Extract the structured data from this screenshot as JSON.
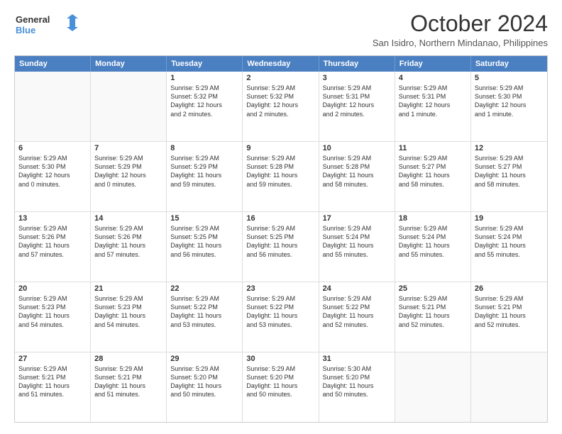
{
  "logo": {
    "line1": "General",
    "line2": "Blue"
  },
  "title": "October 2024",
  "location": "San Isidro, Northern Mindanao, Philippines",
  "weekdays": [
    "Sunday",
    "Monday",
    "Tuesday",
    "Wednesday",
    "Thursday",
    "Friday",
    "Saturday"
  ],
  "rows": [
    [
      {
        "day": "",
        "lines": []
      },
      {
        "day": "",
        "lines": []
      },
      {
        "day": "1",
        "lines": [
          "Sunrise: 5:29 AM",
          "Sunset: 5:32 PM",
          "Daylight: 12 hours",
          "and 2 minutes."
        ]
      },
      {
        "day": "2",
        "lines": [
          "Sunrise: 5:29 AM",
          "Sunset: 5:32 PM",
          "Daylight: 12 hours",
          "and 2 minutes."
        ]
      },
      {
        "day": "3",
        "lines": [
          "Sunrise: 5:29 AM",
          "Sunset: 5:31 PM",
          "Daylight: 12 hours",
          "and 2 minutes."
        ]
      },
      {
        "day": "4",
        "lines": [
          "Sunrise: 5:29 AM",
          "Sunset: 5:31 PM",
          "Daylight: 12 hours",
          "and 1 minute."
        ]
      },
      {
        "day": "5",
        "lines": [
          "Sunrise: 5:29 AM",
          "Sunset: 5:30 PM",
          "Daylight: 12 hours",
          "and 1 minute."
        ]
      }
    ],
    [
      {
        "day": "6",
        "lines": [
          "Sunrise: 5:29 AM",
          "Sunset: 5:30 PM",
          "Daylight: 12 hours",
          "and 0 minutes."
        ]
      },
      {
        "day": "7",
        "lines": [
          "Sunrise: 5:29 AM",
          "Sunset: 5:29 PM",
          "Daylight: 12 hours",
          "and 0 minutes."
        ]
      },
      {
        "day": "8",
        "lines": [
          "Sunrise: 5:29 AM",
          "Sunset: 5:29 PM",
          "Daylight: 11 hours",
          "and 59 minutes."
        ]
      },
      {
        "day": "9",
        "lines": [
          "Sunrise: 5:29 AM",
          "Sunset: 5:28 PM",
          "Daylight: 11 hours",
          "and 59 minutes."
        ]
      },
      {
        "day": "10",
        "lines": [
          "Sunrise: 5:29 AM",
          "Sunset: 5:28 PM",
          "Daylight: 11 hours",
          "and 58 minutes."
        ]
      },
      {
        "day": "11",
        "lines": [
          "Sunrise: 5:29 AM",
          "Sunset: 5:27 PM",
          "Daylight: 11 hours",
          "and 58 minutes."
        ]
      },
      {
        "day": "12",
        "lines": [
          "Sunrise: 5:29 AM",
          "Sunset: 5:27 PM",
          "Daylight: 11 hours",
          "and 58 minutes."
        ]
      }
    ],
    [
      {
        "day": "13",
        "lines": [
          "Sunrise: 5:29 AM",
          "Sunset: 5:26 PM",
          "Daylight: 11 hours",
          "and 57 minutes."
        ]
      },
      {
        "day": "14",
        "lines": [
          "Sunrise: 5:29 AM",
          "Sunset: 5:26 PM",
          "Daylight: 11 hours",
          "and 57 minutes."
        ]
      },
      {
        "day": "15",
        "lines": [
          "Sunrise: 5:29 AM",
          "Sunset: 5:25 PM",
          "Daylight: 11 hours",
          "and 56 minutes."
        ]
      },
      {
        "day": "16",
        "lines": [
          "Sunrise: 5:29 AM",
          "Sunset: 5:25 PM",
          "Daylight: 11 hours",
          "and 56 minutes."
        ]
      },
      {
        "day": "17",
        "lines": [
          "Sunrise: 5:29 AM",
          "Sunset: 5:24 PM",
          "Daylight: 11 hours",
          "and 55 minutes."
        ]
      },
      {
        "day": "18",
        "lines": [
          "Sunrise: 5:29 AM",
          "Sunset: 5:24 PM",
          "Daylight: 11 hours",
          "and 55 minutes."
        ]
      },
      {
        "day": "19",
        "lines": [
          "Sunrise: 5:29 AM",
          "Sunset: 5:24 PM",
          "Daylight: 11 hours",
          "and 55 minutes."
        ]
      }
    ],
    [
      {
        "day": "20",
        "lines": [
          "Sunrise: 5:29 AM",
          "Sunset: 5:23 PM",
          "Daylight: 11 hours",
          "and 54 minutes."
        ]
      },
      {
        "day": "21",
        "lines": [
          "Sunrise: 5:29 AM",
          "Sunset: 5:23 PM",
          "Daylight: 11 hours",
          "and 54 minutes."
        ]
      },
      {
        "day": "22",
        "lines": [
          "Sunrise: 5:29 AM",
          "Sunset: 5:22 PM",
          "Daylight: 11 hours",
          "and 53 minutes."
        ]
      },
      {
        "day": "23",
        "lines": [
          "Sunrise: 5:29 AM",
          "Sunset: 5:22 PM",
          "Daylight: 11 hours",
          "and 53 minutes."
        ]
      },
      {
        "day": "24",
        "lines": [
          "Sunrise: 5:29 AM",
          "Sunset: 5:22 PM",
          "Daylight: 11 hours",
          "and 52 minutes."
        ]
      },
      {
        "day": "25",
        "lines": [
          "Sunrise: 5:29 AM",
          "Sunset: 5:21 PM",
          "Daylight: 11 hours",
          "and 52 minutes."
        ]
      },
      {
        "day": "26",
        "lines": [
          "Sunrise: 5:29 AM",
          "Sunset: 5:21 PM",
          "Daylight: 11 hours",
          "and 52 minutes."
        ]
      }
    ],
    [
      {
        "day": "27",
        "lines": [
          "Sunrise: 5:29 AM",
          "Sunset: 5:21 PM",
          "Daylight: 11 hours",
          "and 51 minutes."
        ]
      },
      {
        "day": "28",
        "lines": [
          "Sunrise: 5:29 AM",
          "Sunset: 5:21 PM",
          "Daylight: 11 hours",
          "and 51 minutes."
        ]
      },
      {
        "day": "29",
        "lines": [
          "Sunrise: 5:29 AM",
          "Sunset: 5:20 PM",
          "Daylight: 11 hours",
          "and 50 minutes."
        ]
      },
      {
        "day": "30",
        "lines": [
          "Sunrise: 5:29 AM",
          "Sunset: 5:20 PM",
          "Daylight: 11 hours",
          "and 50 minutes."
        ]
      },
      {
        "day": "31",
        "lines": [
          "Sunrise: 5:30 AM",
          "Sunset: 5:20 PM",
          "Daylight: 11 hours",
          "and 50 minutes."
        ]
      },
      {
        "day": "",
        "lines": []
      },
      {
        "day": "",
        "lines": []
      }
    ]
  ]
}
